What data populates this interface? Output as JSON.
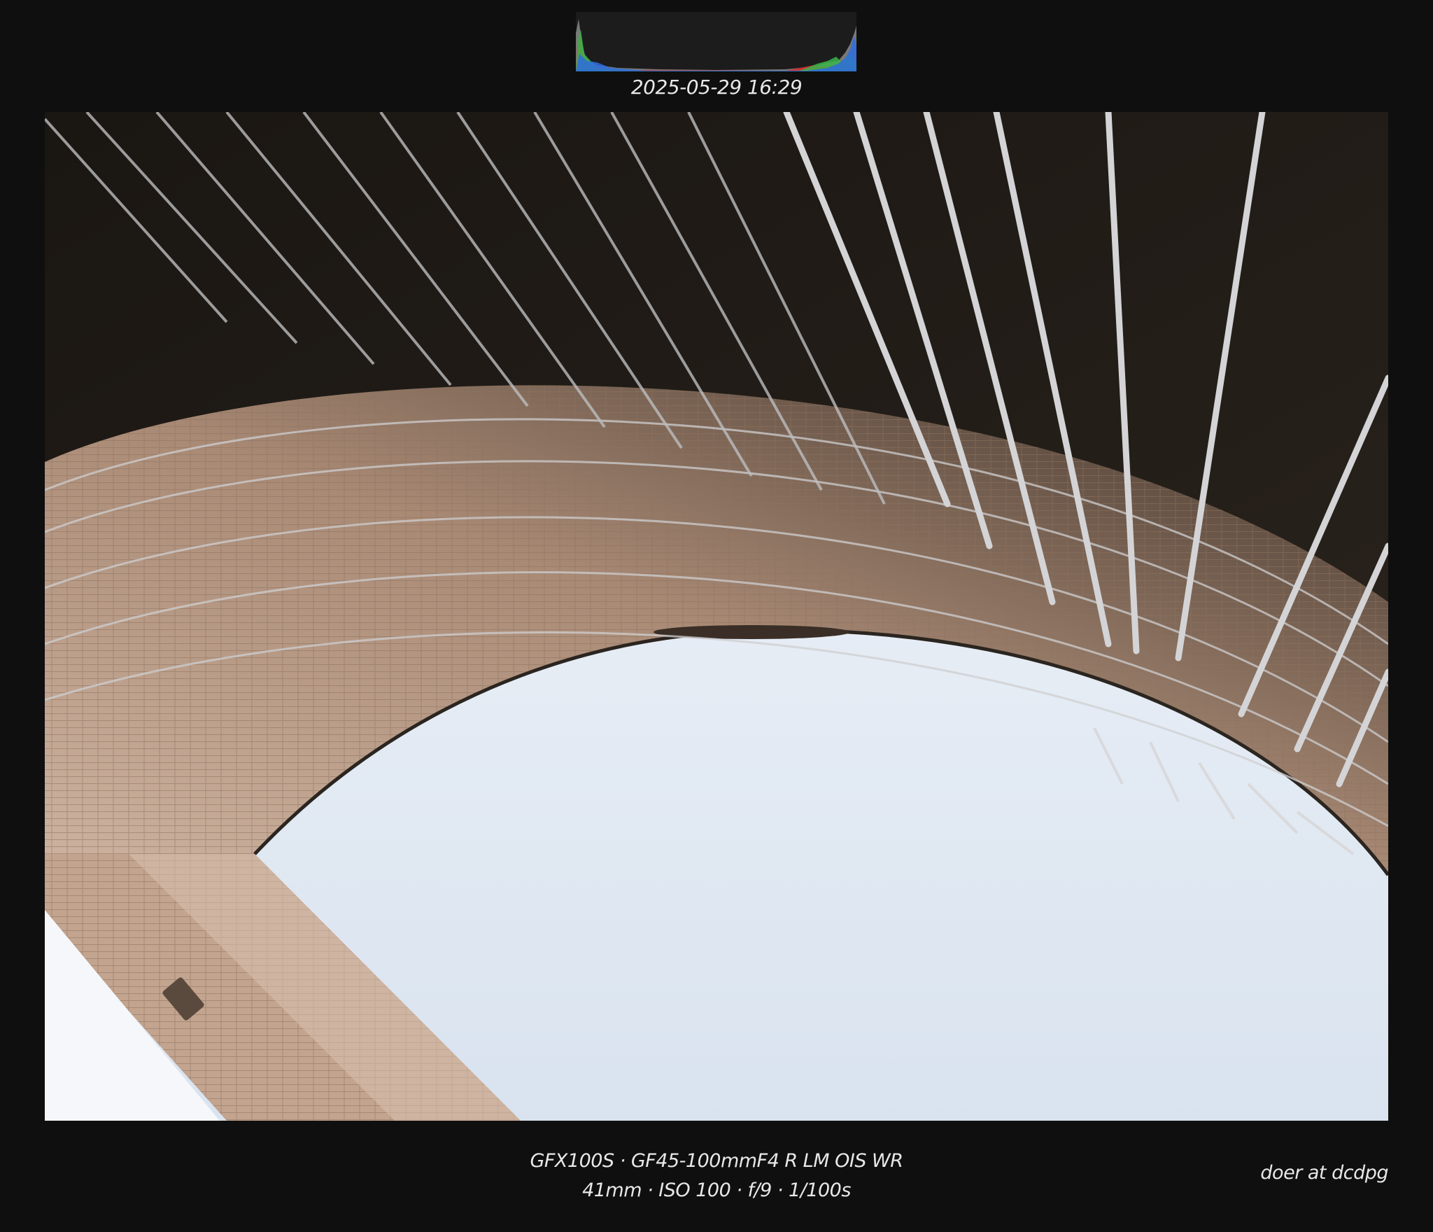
{
  "histogram": {
    "channels": [
      "red",
      "green",
      "blue",
      "luminance"
    ],
    "colors": {
      "red": "#d8262c",
      "green": "#39b54a",
      "blue": "#2d6cdf",
      "luminance": "#9a9a9a"
    }
  },
  "timestamp": "2025-05-29 16:29",
  "photo": {
    "subject": "upward view of a curved architectural arch with metal railings against the sky",
    "colors": {
      "sky": "#e6edf6",
      "arch": "#b79a85",
      "shadow": "#1e1915",
      "rail": "#cfcfd1"
    }
  },
  "caption": {
    "camera_line": "GFX100S · GF45-100mmF4 R LM OIS WR",
    "exposure_line": "41mm · ISO 100 · f/9 · 1/100s"
  },
  "credit": "doer at dcdpg"
}
